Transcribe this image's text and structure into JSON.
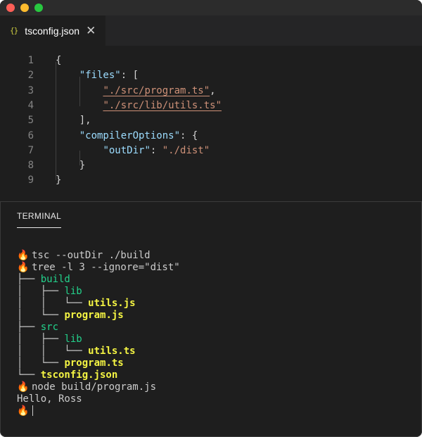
{
  "window": {
    "traffic_lights": [
      "close",
      "minimize",
      "zoom"
    ]
  },
  "tab": {
    "icon": "{}",
    "filename": "tsconfig.json",
    "close_glyph": "✕"
  },
  "editor": {
    "line_numbers": [
      "1",
      "2",
      "3",
      "4",
      "5",
      "6",
      "7",
      "8",
      "9"
    ],
    "lines": [
      [
        {
          "t": "{",
          "c": "p"
        }
      ],
      [
        {
          "t": "    ",
          "c": "p"
        },
        {
          "t": "\"files\"",
          "c": "key"
        },
        {
          "t": ": [",
          "c": "p"
        }
      ],
      [
        {
          "t": "        ",
          "c": "p"
        },
        {
          "t": "\"./src/program.ts\"",
          "c": "strlink"
        },
        {
          "t": ",",
          "c": "p"
        }
      ],
      [
        {
          "t": "        ",
          "c": "p"
        },
        {
          "t": "\"./src/lib/utils.ts\"",
          "c": "strlink"
        }
      ],
      [
        {
          "t": "    ],",
          "c": "p"
        }
      ],
      [
        {
          "t": "    ",
          "c": "p"
        },
        {
          "t": "\"compilerOptions\"",
          "c": "key"
        },
        {
          "t": ": {",
          "c": "p"
        }
      ],
      [
        {
          "t": "        ",
          "c": "p"
        },
        {
          "t": "\"outDir\"",
          "c": "key"
        },
        {
          "t": ": ",
          "c": "p"
        },
        {
          "t": "\"./dist\"",
          "c": "str"
        }
      ],
      [
        {
          "t": "    }",
          "c": "p"
        }
      ],
      [
        {
          "t": "}",
          "c": "p"
        }
      ]
    ]
  },
  "panel": {
    "active_tab": "TERMINAL"
  },
  "terminal": {
    "prompt_icon": "🔥",
    "lines": [
      [
        {
          "t": "🔥",
          "c": "prompt"
        },
        {
          "t": "tsc --outDir ./build",
          "c": "plain"
        }
      ],
      [
        {
          "t": "🔥",
          "c": "prompt"
        },
        {
          "t": "tree -l 3 --ignore=\"dist\"",
          "c": "plain"
        }
      ],
      [
        {
          "t": "├── ",
          "c": "tree"
        },
        {
          "t": "build",
          "c": "dir"
        }
      ],
      [
        {
          "t": "│   ├── ",
          "c": "tree"
        },
        {
          "t": "lib",
          "c": "dir"
        }
      ],
      [
        {
          "t": "│   │   └── ",
          "c": "tree"
        },
        {
          "t": "utils.js",
          "c": "file"
        }
      ],
      [
        {
          "t": "│   └── ",
          "c": "tree"
        },
        {
          "t": "program.js",
          "c": "file"
        }
      ],
      [
        {
          "t": "├── ",
          "c": "tree"
        },
        {
          "t": "src",
          "c": "dir"
        }
      ],
      [
        {
          "t": "│   ├── ",
          "c": "tree"
        },
        {
          "t": "lib",
          "c": "dir"
        }
      ],
      [
        {
          "t": "│   │   └── ",
          "c": "tree"
        },
        {
          "t": "utils.ts",
          "c": "file"
        }
      ],
      [
        {
          "t": "│   └── ",
          "c": "tree"
        },
        {
          "t": "program.ts",
          "c": "file"
        }
      ],
      [
        {
          "t": "└── ",
          "c": "tree"
        },
        {
          "t": "tsconfig.json",
          "c": "file"
        }
      ],
      [
        {
          "t": "🔥",
          "c": "prompt"
        },
        {
          "t": "node build/program.js",
          "c": "plain"
        }
      ],
      [
        {
          "t": "Hello, Ross",
          "c": "plain"
        }
      ],
      [
        {
          "t": "🔥",
          "c": "prompt"
        },
        {
          "t": "",
          "c": "cursor"
        }
      ]
    ]
  },
  "colors": {
    "editor_bg": "#1e1e1e",
    "key": "#9cdcfe",
    "string": "#ce9178",
    "dir": "#23d18b",
    "file": "#f5f543",
    "text": "#cccccc"
  }
}
